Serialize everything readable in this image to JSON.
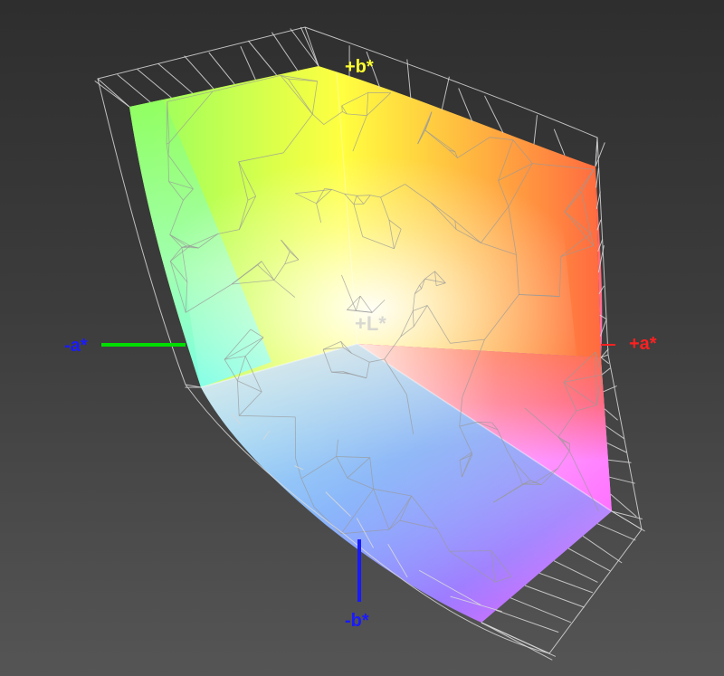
{
  "axes": {
    "plus_b": {
      "label": "+b*",
      "color": "#ffff33"
    },
    "minus_a": {
      "label": "-a*",
      "color": "#1a1aff"
    },
    "plus_a": {
      "label": "+a*",
      "color": "#ff2020"
    },
    "minus_b": {
      "label": "-b*",
      "color": "#1a1aff"
    },
    "plus_l": {
      "label": "+L*",
      "color": "#cccccc"
    }
  },
  "axis_line_colors": {
    "minus_a": "#00dd00",
    "plus_a": "#ff2020",
    "minus_b": "#1a1aff"
  },
  "gamut_colors": {
    "yellow": "#ffff40",
    "green": "#90ff60",
    "cyan": "#70ffff",
    "white": "#f4f4f4",
    "red": "#ff6060",
    "orange": "#ff8c40",
    "magenta": "#ff70ff",
    "blue": "#6a8cff",
    "violet": "#b070ff"
  }
}
